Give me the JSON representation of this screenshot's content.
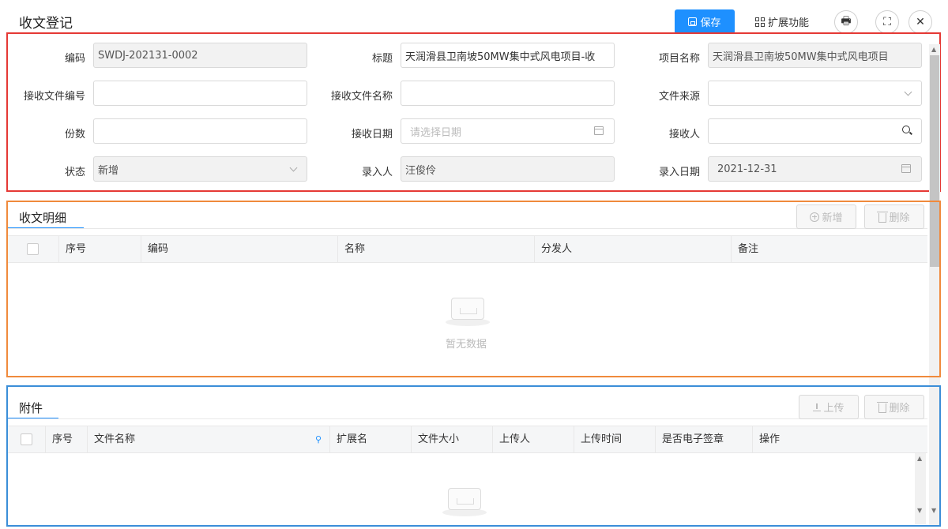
{
  "header": {
    "title": "收文登记",
    "save_label": "保存",
    "extend_label": "扩展功能",
    "print_icon": "🖶",
    "fullscreen_icon": "⛶",
    "close_icon": "✕"
  },
  "form": {
    "code": {
      "label": "编码",
      "value": "SWDJ-202131-0002"
    },
    "title": {
      "label": "标题",
      "value": "天润滑县卫南坡50MW集中式风电项目-收"
    },
    "project_name": {
      "label": "项目名称",
      "value": "天润滑县卫南坡50MW集中式风电项目"
    },
    "recv_doc_no": {
      "label": "接收文件编号",
      "value": ""
    },
    "recv_doc_name": {
      "label": "接收文件名称",
      "value": ""
    },
    "doc_source": {
      "label": "文件来源",
      "value": ""
    },
    "copies": {
      "label": "份数",
      "value": ""
    },
    "recv_date": {
      "label": "接收日期",
      "placeholder": "请选择日期"
    },
    "receiver": {
      "label": "接收人",
      "value": ""
    },
    "status": {
      "label": "状态",
      "value": "新增"
    },
    "entered_by": {
      "label": "录入人",
      "value": "汪俊伶"
    },
    "entry_date": {
      "label": "录入日期",
      "value": "2021-12-31"
    }
  },
  "detail": {
    "title": "收文明细",
    "add_label": "新增",
    "delete_label": "删除",
    "columns": [
      "序号",
      "编码",
      "名称",
      "分发人",
      "备注"
    ],
    "empty_text": "暂无数据"
  },
  "attachments": {
    "title": "附件",
    "upload_label": "上传",
    "delete_label": "删除",
    "columns": [
      "序号",
      "文件名称",
      "扩展名",
      "文件大小",
      "上传人",
      "上传时间",
      "是否电子签章",
      "操作"
    ]
  },
  "colors": {
    "primary": "#1e90ff",
    "red_outline": "#e53935",
    "orange_outline": "#f08a3c",
    "blue_outline": "#3b8ed8"
  }
}
